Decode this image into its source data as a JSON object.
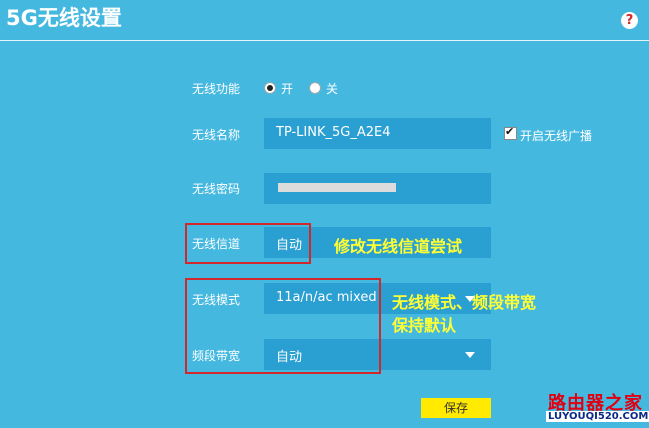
{
  "page": {
    "title": "5G无线设置",
    "help_icon_symbol": "?"
  },
  "form": {
    "wireless_function": {
      "label": "无线功能",
      "options": [
        "开",
        "关"
      ],
      "selected": "开"
    },
    "ssid": {
      "label": "无线名称",
      "value": "TP-LINK_5G_A2E4",
      "broadcast_label": "开启无线广播",
      "broadcast_checked": true
    },
    "password": {
      "label": "无线密码",
      "value": ""
    },
    "channel": {
      "label": "无线信道",
      "value": "自动"
    },
    "mode": {
      "label": "无线模式",
      "value": "11a/n/ac mixed"
    },
    "bandwidth": {
      "label": "频段带宽",
      "value": "自动"
    },
    "save_label": "保存"
  },
  "annotations": {
    "channel_note": "修改无线信道尝试",
    "mode_note_line1": "无线模式、频段带宽",
    "mode_note_line2": "保持默认"
  },
  "watermark": {
    "top": "路由器之家",
    "bottom": "LUYOUQI520.COM"
  },
  "colors": {
    "background": "#45b8e0",
    "field": "#2a9fd2",
    "highlight_box": "#d0282b",
    "annotation": "#ffff33",
    "save_button": "#ffea00"
  }
}
